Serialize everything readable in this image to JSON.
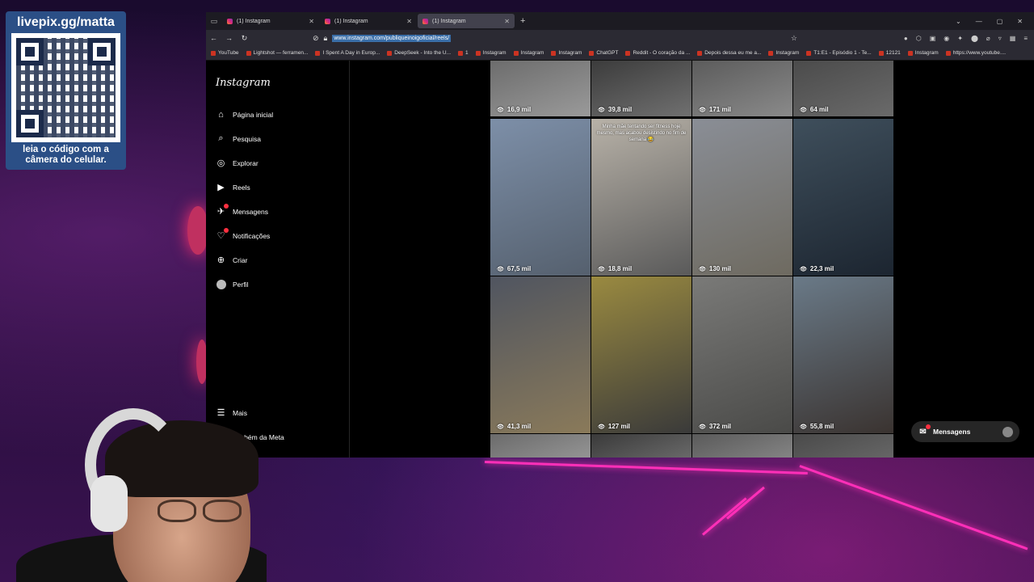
{
  "overlay": {
    "qr_url": "livepix.gg/matta",
    "qr_caption": "leia o código com a câmera do celular."
  },
  "browser": {
    "tabs": [
      {
        "title": "(1) Instagram",
        "active": false
      },
      {
        "title": "(1) Instagram",
        "active": false
      },
      {
        "title": "(1) Instagram",
        "active": true
      }
    ],
    "url": "www.instagram.com/publiqueinoigoficial/reels/",
    "bookmarks": [
      "YouTube",
      "Lightshot — ferramen...",
      "I Spent A Day in Europ...",
      "DeepSeek - Into the U...",
      "1",
      "Instagram",
      "Instagram",
      "Instagram",
      "ChatGPT",
      "Reddit - O coração da ...",
      "Depois dessa eu me a...",
      "Instagram",
      "T1:E1 - Episódio 1 - Te...",
      "12121",
      "Instagram",
      "https://www.youtube...."
    ]
  },
  "instagram": {
    "logo": "Instagram",
    "nav": [
      {
        "label": "Página inicial",
        "icon": "home-icon"
      },
      {
        "label": "Pesquisa",
        "icon": "search-icon"
      },
      {
        "label": "Explorar",
        "icon": "compass-icon"
      },
      {
        "label": "Reels",
        "icon": "reels-icon"
      },
      {
        "label": "Mensagens",
        "icon": "messenger-icon"
      },
      {
        "label": "Notificações",
        "icon": "heart-icon"
      },
      {
        "label": "Criar",
        "icon": "plus-icon"
      },
      {
        "label": "Perfil",
        "icon": "avatar-icon"
      }
    ],
    "more_label": "Mais",
    "meta_label": "também da Meta",
    "reels": [
      {
        "views": "16,9 mil"
      },
      {
        "views": "39,8 mil"
      },
      {
        "views": "171 mil"
      },
      {
        "views": "64 mil"
      },
      {
        "views": "67,5 mil"
      },
      {
        "views": "18,8 mil"
      },
      {
        "views": "130 mil"
      },
      {
        "views": "22,3 mil"
      },
      {
        "views": "41,3 mil"
      },
      {
        "views": "127 mil"
      },
      {
        "views": "372 mil"
      },
      {
        "views": "55,8 mil"
      }
    ],
    "reel_caption": "Minha mãe tentando ser fitness hoje mesmo, mas acabou desistindo no fim de semana 😂",
    "messages_label": "Mensagens"
  }
}
